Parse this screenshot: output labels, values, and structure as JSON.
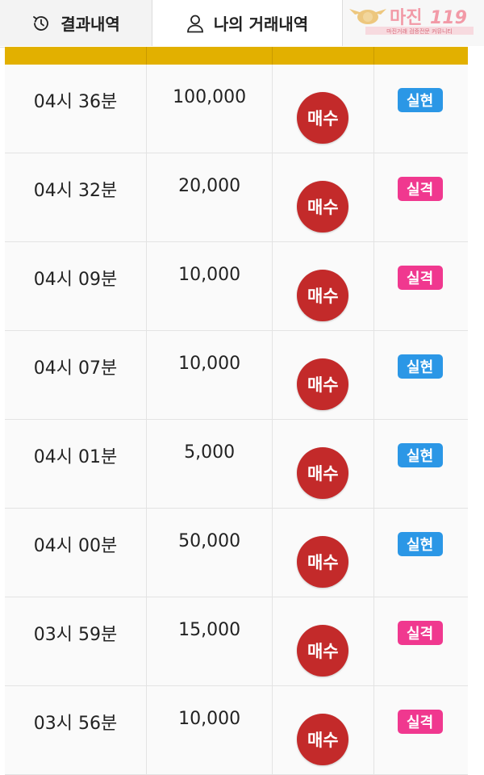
{
  "tabs": [
    {
      "label": "결과내역",
      "icon": "history-icon"
    },
    {
      "label": "나의 거래내역",
      "icon": "user-icon"
    }
  ],
  "logo": {
    "text": "마진119",
    "subtitle": "마진거래 검증전문 커뮤니티"
  },
  "colors": {
    "header_bar": "#e2b000",
    "buy_button": "#c32a2a",
    "success_badge": "#2b97e6",
    "fail_badge": "#f0388f"
  },
  "trades": [
    {
      "time": "04시 36분",
      "amount": "100,000",
      "action": "매수",
      "result": "실현",
      "result_type": "success"
    },
    {
      "time": "04시 32분",
      "amount": "20,000",
      "action": "매수",
      "result": "실격",
      "result_type": "fail"
    },
    {
      "time": "04시 09분",
      "amount": "10,000",
      "action": "매수",
      "result": "실격",
      "result_type": "fail"
    },
    {
      "time": "04시 07분",
      "amount": "10,000",
      "action": "매수",
      "result": "실현",
      "result_type": "success"
    },
    {
      "time": "04시 01분",
      "amount": "5,000",
      "action": "매수",
      "result": "실현",
      "result_type": "success"
    },
    {
      "time": "04시 00분",
      "amount": "50,000",
      "action": "매수",
      "result": "실현",
      "result_type": "success"
    },
    {
      "time": "03시 59분",
      "amount": "15,000",
      "action": "매수",
      "result": "실격",
      "result_type": "fail"
    },
    {
      "time": "03시 56분",
      "amount": "10,000",
      "action": "매수",
      "result": "실격",
      "result_type": "fail"
    }
  ]
}
